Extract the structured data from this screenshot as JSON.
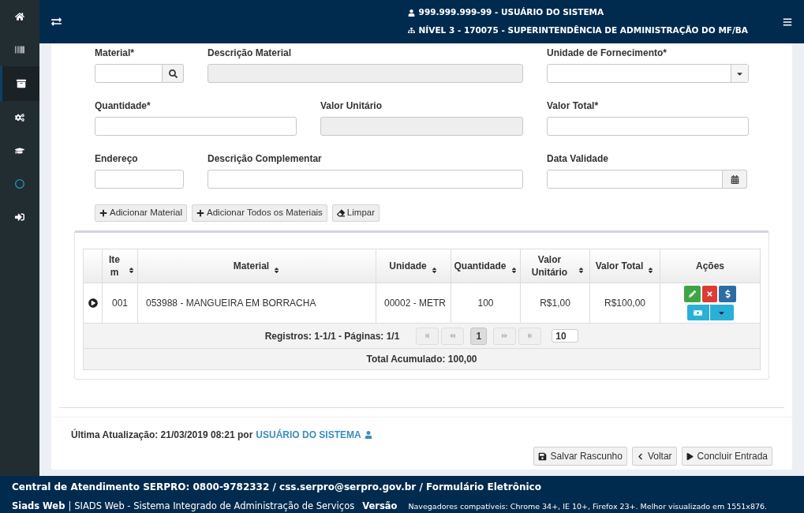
{
  "sidebar": {
    "items": [
      {
        "selected": false
      },
      {
        "selected": false
      },
      {
        "selected": true
      },
      {
        "selected": false
      },
      {
        "selected": false
      },
      {
        "selected": false
      },
      {
        "selected": false
      }
    ]
  },
  "header": {
    "user": "999.999.999-99 - USUÁRIO DO SISTEMA",
    "unit": "NÍVEL 3 - 170075 - SUPERINTENDÊNCIA DE ADMINISTRAÇÃO DO MF/BA"
  },
  "form": {
    "rows": [
      {
        "fields": [
          {
            "label": "Material*",
            "kind": "search",
            "disabled": false
          },
          {
            "label": "Descrição Material",
            "kind": "text",
            "disabled": true
          },
          {
            "label": "Unidade de Fornecimento*",
            "kind": "select",
            "disabled": false
          }
        ]
      },
      {
        "fields": [
          {
            "label": "Quantidade*",
            "kind": "text",
            "disabled": false
          },
          {
            "label": "Valor Unitário",
            "kind": "text",
            "disabled": true
          },
          {
            "label": "Valor Total*",
            "kind": "text",
            "disabled": false
          }
        ]
      },
      {
        "fields": [
          {
            "label": "Endereço",
            "kind": "text",
            "disabled": false
          },
          {
            "label": "Descrição Complementar",
            "kind": "text",
            "disabled": false
          },
          {
            "label": "Data Validade",
            "kind": "date",
            "disabled": false
          }
        ]
      }
    ],
    "buttons": [
      {
        "label": "Adicionar Material",
        "kind": "plus"
      },
      {
        "label": "Adicionar Todos os Materiais",
        "kind": "plus"
      },
      {
        "label": "Limpar",
        "kind": "eraser"
      }
    ]
  },
  "table": {
    "columns": [
      {
        "sortable": false
      },
      {
        "label": "Item",
        "sortable": true
      },
      {
        "label": "Material",
        "sortable": true
      },
      {
        "label": "Unidade",
        "sortable": true
      },
      {
        "label": "Quantidade",
        "sortable": true
      },
      {
        "label": "Valor Unitário",
        "sortable": true
      },
      {
        "label": "Valor Total",
        "sortable": true
      },
      {
        "label": "Ações",
        "sortable": false
      }
    ],
    "rows": [
      {
        "item": "001",
        "material": "053988 - MANGUEIRA EM BORRACHA",
        "unit": "00002 - METR",
        "quantity": "100",
        "unit_value": "R$1,00",
        "total_value": "R$100,00"
      }
    ],
    "pagination": {
      "summary": "Registros: 1-1/1 - Páginas: 1/1",
      "pages": [
        {
          "label": "1",
          "selected": true
        }
      ],
      "page_size": "10"
    },
    "total": "Total Acumulado: 100,00"
  },
  "last_update": {
    "text": "Última Atualização: 21/03/2019 08:21 por",
    "user": "USUÁRIO DO SISTEMA"
  },
  "actions": [
    {
      "label": "Salvar Rascunho",
      "kind": "save"
    },
    {
      "label": "Voltar",
      "kind": "back"
    },
    {
      "label": "Concluir Entrada",
      "kind": "play"
    }
  ],
  "footer": {
    "contact": "Central de Atendimento SERPRO: 0800-9782332 / css.serpro@serpro.gov.br / Formulário Eletrônico",
    "app": "Siads Web",
    "separator": "|",
    "description": "SIADS Web - Sistema Integrado de Administração de Serviços",
    "version": "Versão",
    "browsers": "Navegadores compatíveis: Chrome 34+, IE 10+, Firefox 23+. Melhor visualizado em 1551x876."
  }
}
